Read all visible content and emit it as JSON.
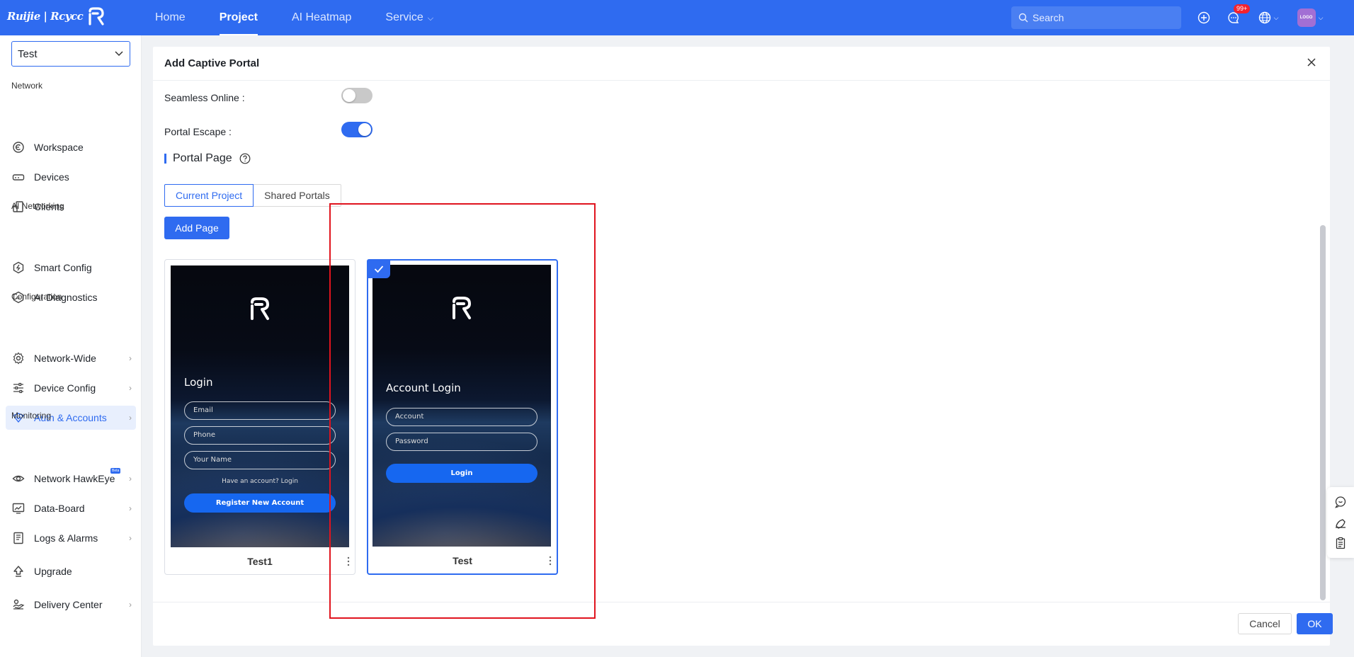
{
  "brand": {
    "name": "Ruijie | Rcycc"
  },
  "nav": {
    "items": [
      {
        "label": "Home"
      },
      {
        "label": "Project"
      },
      {
        "label": "AI Heatmap"
      },
      {
        "label": "Service"
      }
    ],
    "active_index": 1,
    "search_placeholder": "Search",
    "notification_badge": "99+",
    "avatar_text": "LOGO"
  },
  "sidebar": {
    "project_select": "Test",
    "groups": {
      "network": "Network",
      "ai_networking": "AI Networking",
      "configuration": "Configuration",
      "monitoring": "Monitoring"
    },
    "items": {
      "workspace": "Workspace",
      "devices": "Devices",
      "clients": "Clients",
      "smart_config": "Smart Config",
      "ai_diagnostics": "AI Diagnostics",
      "network_wide": "Network-Wide",
      "device_config": "Device Config",
      "auth_accounts": "Auth & Accounts",
      "network_hawkeye": "Network HawkEye",
      "data_board": "Data-Board",
      "logs_alarms": "Logs & Alarms",
      "upgrade": "Upgrade",
      "delivery_center": "Delivery Center"
    },
    "active_item": "auth_accounts",
    "beta_badge": "Beta"
  },
  "modal": {
    "title": "Add Captive Portal",
    "fields": {
      "seamless_online": {
        "label": "Seamless Online :",
        "enabled": false
      },
      "portal_escape": {
        "label": "Portal Escape :",
        "enabled": true
      }
    },
    "section_title": "Portal Page",
    "tabs": [
      {
        "label": "Current Project",
        "active": true
      },
      {
        "label": "Shared Portals",
        "active": false
      }
    ],
    "add_page_label": "Add Page",
    "cards": [
      {
        "name": "Test1",
        "selected": false,
        "preview": {
          "title": "Login",
          "inputs": [
            "Email",
            "Phone",
            "Your Name"
          ],
          "link": "Have an account? Login",
          "button": "Register New Account"
        }
      },
      {
        "name": "Test",
        "selected": true,
        "preview": {
          "title": "Account Login",
          "inputs": [
            "Account",
            "Password"
          ],
          "button": "Login"
        }
      }
    ],
    "cancel_label": "Cancel",
    "ok_label": "OK"
  },
  "colors": {
    "primary": "#2f6bf0",
    "highlight": "#e0141e",
    "badge": "#f5222d"
  }
}
